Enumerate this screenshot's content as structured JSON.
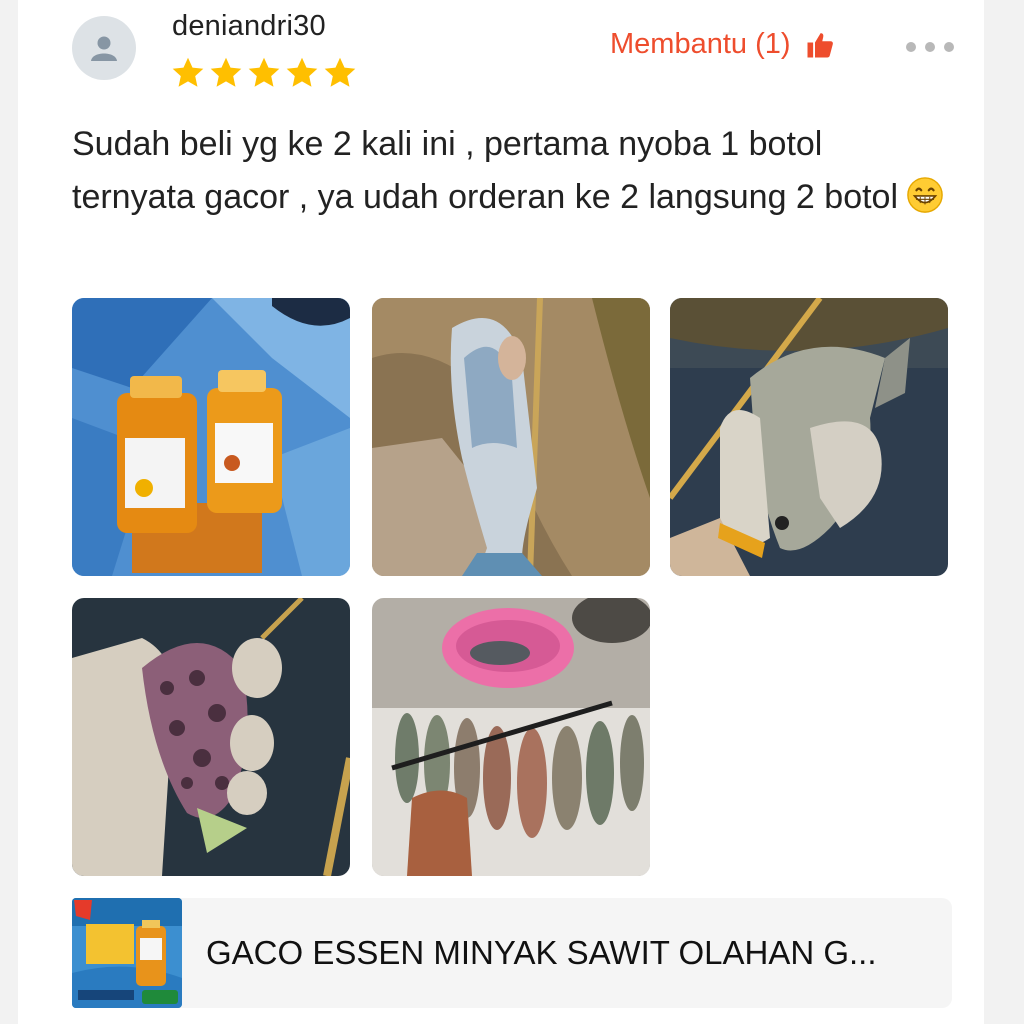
{
  "review": {
    "username": "deniandri30",
    "rating": 5,
    "rating_max": 5,
    "helpful_label": "Membantu (1)",
    "text": "Sudah beli yg ke 2 kali ini , pertama nyoba 1 botol ternyata gacor , ya udah orderan ke 2 langsung 2 botol",
    "emoji": "grinning-face-icon",
    "photos_count": 5
  },
  "product": {
    "name": "GACO ESSEN MINYAK SAWIT OLAHAN G..."
  },
  "colors": {
    "accent": "#ee4d2d",
    "star": "#ffbf00",
    "text": "#222222",
    "card_bg": "#ffffff",
    "page_bg": "#f2f2f2",
    "product_bg": "#f5f5f5"
  },
  "icons": {
    "avatar": "user-icon",
    "helpful": "thumbs-up-icon",
    "more": "more-options-icon",
    "star": "star-icon"
  }
}
